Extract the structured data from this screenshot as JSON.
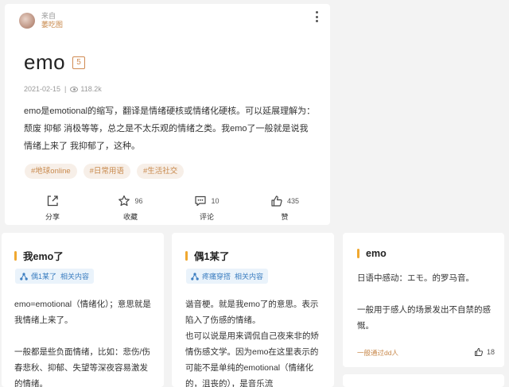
{
  "main": {
    "source_from": "来自",
    "source_name": "萎吃图",
    "title": "emo",
    "count_badge": "5",
    "date": "2021-02-15",
    "separator": "|",
    "views": "118.2k",
    "description": "emo是emotional的缩写，翻译是情绪硬核或情绪化硬核。可以延展理解为：颓废 抑郁 消极等等，总之是不太乐观的情绪之类。我emo了一般就是说我情绪上来了 我抑郁了，这种。",
    "tags": [
      "#地球online",
      "#日常用语",
      "#生活社交"
    ],
    "actions": {
      "share_label": "分享",
      "collect_label": "收藏",
      "collect_count": "96",
      "comment_label": "评论",
      "comment_count": "10",
      "like_label": "赞",
      "like_count": "435"
    }
  },
  "cards": [
    {
      "title": "我emo了",
      "chip_name": "偶1某了",
      "chip_related": "相关内容",
      "body": "emo=emotional（情绪化）；意思就是我情绪上来了。\n\n一般都是些负面情绪，比如：悲伤/伤春悲秋、抑郁、失望等深夜容易激发的情绪。"
    },
    {
      "title": "偶1某了",
      "chip_name": "疼痛穿搭",
      "chip_related": "相关内容",
      "body": "谐音梗。就是我emo了的意思。表示陷入了伤感的情绪。\n也可以说是用来调侃自己夜来非的矫情伤感文学。因为emo在这里表示的可能不是单纯的emotional（情绪化的，沮丧的），是音乐流"
    },
    {
      "title": "emo",
      "body": "日语中感动：エモ。的罗马音。\n\n一般用于感人的场景发出不自禁的感慨。",
      "footer": "一般通过dd人",
      "like_count": "18"
    }
  ],
  "colors": {
    "accent_orange": "#c8894c",
    "accent_bar": "#f0a830",
    "chip_blue": "#3e7fc1",
    "background": "#f3f3f3"
  }
}
